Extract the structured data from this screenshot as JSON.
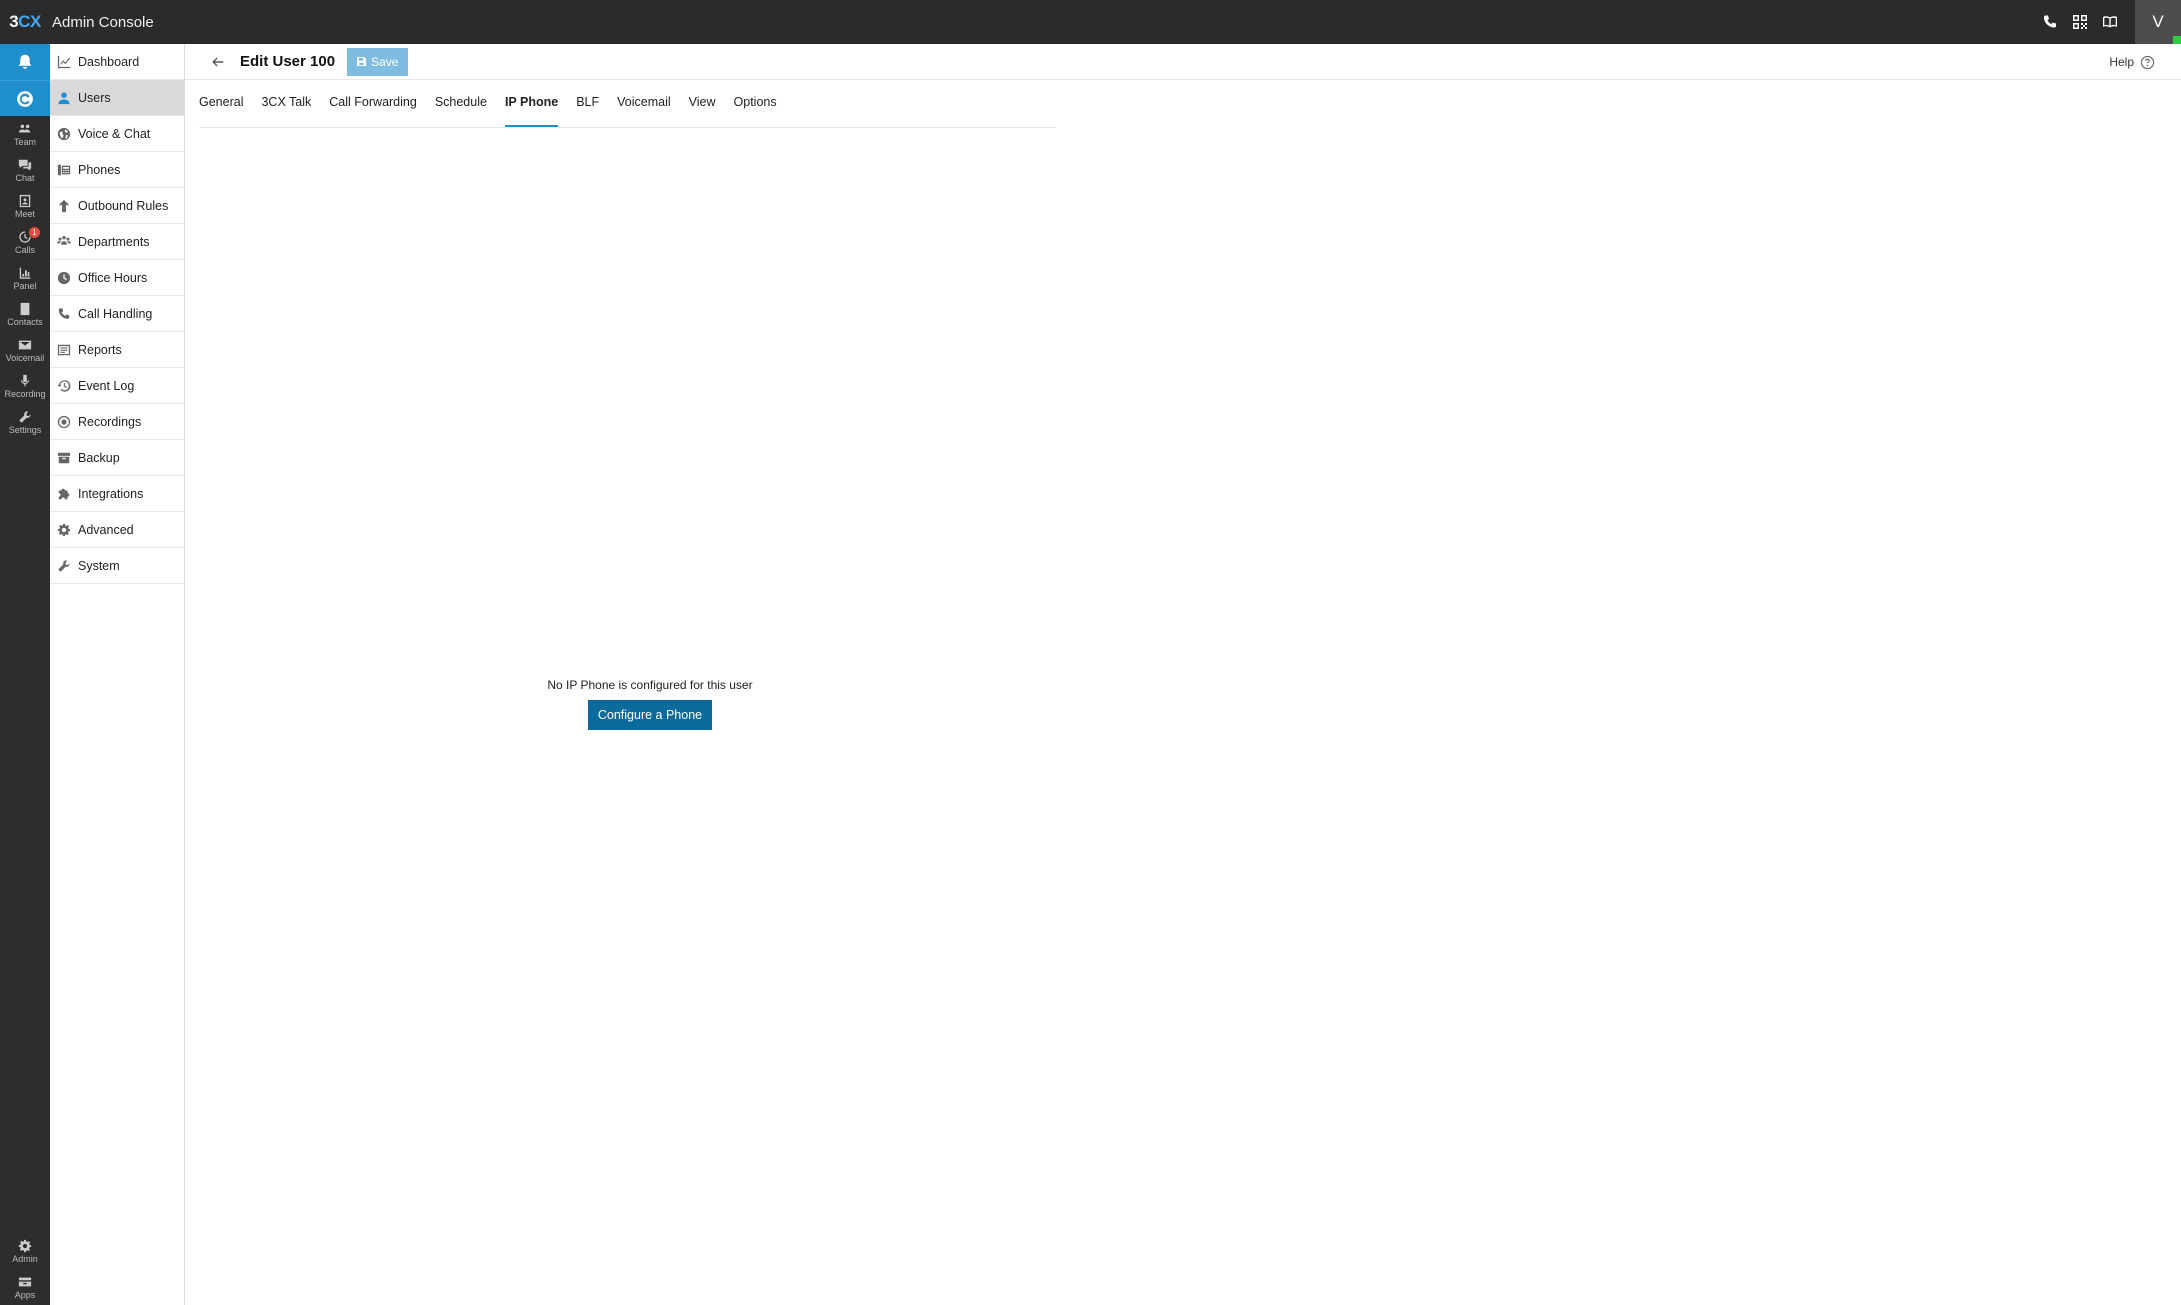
{
  "topbar": {
    "logo_prefix": "3",
    "logo_suffix": "CX",
    "app_title": "Admin Console",
    "avatar_initial": "V",
    "icons": [
      "phone-icon",
      "qr-code-icon",
      "book-icon"
    ]
  },
  "rail": {
    "items": [
      {
        "label": "Team",
        "icon": "team-icon"
      },
      {
        "label": "Chat",
        "icon": "chat-icon"
      },
      {
        "label": "Meet",
        "icon": "meet-icon"
      },
      {
        "label": "Calls",
        "icon": "calls-icon",
        "badge": "1"
      },
      {
        "label": "Panel",
        "icon": "panel-icon"
      },
      {
        "label": "Contacts",
        "icon": "contacts-icon"
      },
      {
        "label": "Voicemail",
        "icon": "voicemail-icon"
      },
      {
        "label": "Recording",
        "icon": "recording-icon"
      },
      {
        "label": "Settings",
        "icon": "settings-icon"
      }
    ],
    "bottom": [
      {
        "label": "Admin",
        "icon": "admin-icon"
      },
      {
        "label": "Apps",
        "icon": "apps-icon"
      }
    ]
  },
  "sidebar": {
    "items": [
      {
        "label": "Dashboard",
        "icon": "dashboard-icon"
      },
      {
        "label": "Users",
        "icon": "user-icon",
        "active": true
      },
      {
        "label": "Voice & Chat",
        "icon": "globe-icon"
      },
      {
        "label": "Phones",
        "icon": "phone-device-icon"
      },
      {
        "label": "Outbound Rules",
        "icon": "arrow-up-icon"
      },
      {
        "label": "Departments",
        "icon": "departments-icon"
      },
      {
        "label": "Office Hours",
        "icon": "clock-icon"
      },
      {
        "label": "Call Handling",
        "icon": "call-handling-icon"
      },
      {
        "label": "Reports",
        "icon": "reports-icon"
      },
      {
        "label": "Event Log",
        "icon": "history-icon"
      },
      {
        "label": "Recordings",
        "icon": "record-icon"
      },
      {
        "label": "Backup",
        "icon": "archive-icon"
      },
      {
        "label": "Integrations",
        "icon": "puzzle-icon"
      },
      {
        "label": "Advanced",
        "icon": "gear-icon"
      },
      {
        "label": "System",
        "icon": "wrench-icon"
      }
    ]
  },
  "header": {
    "title": "Edit User 100",
    "save_label": "Save",
    "help_label": "Help"
  },
  "tabs": [
    {
      "label": "General"
    },
    {
      "label": "3CX Talk"
    },
    {
      "label": "Call Forwarding"
    },
    {
      "label": "Schedule"
    },
    {
      "label": "IP Phone",
      "active": true
    },
    {
      "label": "BLF"
    },
    {
      "label": "Voicemail"
    },
    {
      "label": "View"
    },
    {
      "label": "Options"
    }
  ],
  "empty_state": {
    "message": "No IP Phone is configured for this user",
    "button_label": "Configure a Phone"
  },
  "colors": {
    "accent": "#1f8ecd",
    "topbar": "#2b2b2b",
    "primary_button": "#0b6b9c",
    "save_button_disabled": "#7fbde0",
    "badge": "#e74c3c"
  }
}
